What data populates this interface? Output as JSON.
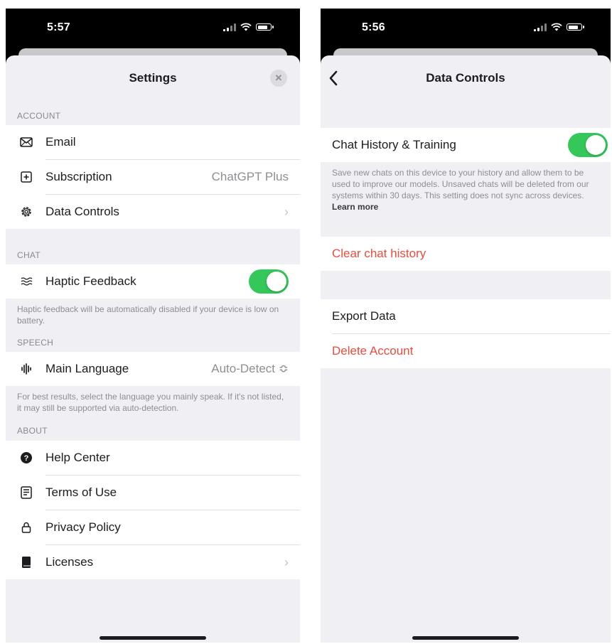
{
  "left_phone": {
    "status_time": "5:57",
    "title": "Settings",
    "close_label": "✕",
    "sections": {
      "account": {
        "header": "ACCOUNT",
        "email_label": "Email",
        "subscription_label": "Subscription",
        "subscription_value": "ChatGPT Plus",
        "data_controls_label": "Data Controls"
      },
      "chat": {
        "header": "CHAT",
        "haptic_label": "Haptic Feedback",
        "haptic_on": true,
        "footnote": "Haptic feedback will be automatically disabled if your device is low on battery."
      },
      "speech": {
        "header": "SPEECH",
        "language_label": "Main Language",
        "language_value": "Auto-Detect ≎",
        "footnote": "For best results, select the language you mainly speak. If it's not listed, it may still be supported via auto-detection."
      },
      "about": {
        "header": "ABOUT",
        "help_label": "Help Center",
        "terms_label": "Terms of Use",
        "privacy_label": "Privacy Policy",
        "licenses_label": "Licenses"
      }
    }
  },
  "right_phone": {
    "status_time": "5:56",
    "title": "Data Controls",
    "chat_history_label": "Chat History & Training",
    "chat_history_on": true,
    "chat_history_footnote": "Save new chats on this device to your history and allow them to be used to improve our models. Unsaved chats will be deleted from our systems within 30 days. This setting does not sync across devices.",
    "learn_more": "Learn more",
    "clear_history_label": "Clear chat history",
    "export_label": "Export Data",
    "delete_label": "Delete Account"
  },
  "colors": {
    "accent_green": "#34c759",
    "destructive_red": "#ea4d3e",
    "background_gray": "#efeff4"
  },
  "icons": [
    "envelope-icon",
    "plus-square-icon",
    "gear-icon",
    "haptic-waves-icon",
    "waveform-icon",
    "question-circle-icon",
    "document-icon",
    "lock-icon",
    "book-icon",
    "chevron-right-icon",
    "back-chevron-icon",
    "close-icon"
  ]
}
